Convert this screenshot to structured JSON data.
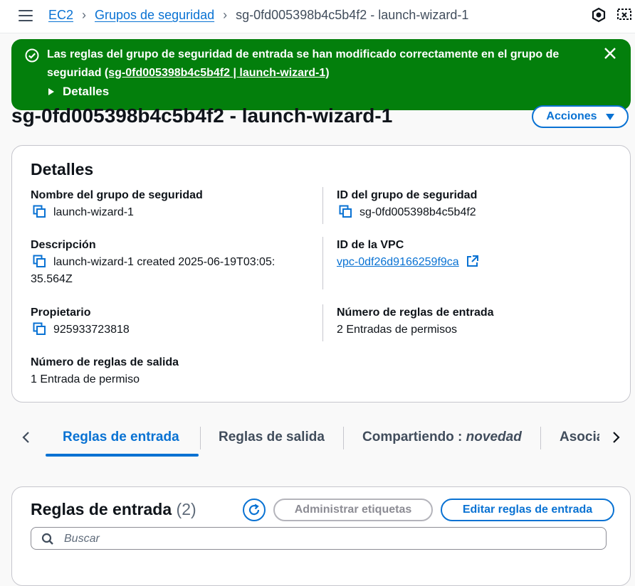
{
  "breadcrumb": {
    "items": [
      "EC2",
      "Grupos de seguridad"
    ],
    "current": "sg-0fd005398b4c5b4f2 - launch-wizard-1"
  },
  "flash": {
    "message": "Las reglas del grupo de seguridad de entrada se han modificado correctamente en el grupo de seguridad",
    "link": "(sg-0fd005398b4c5b4f2 | launch-wizard-1)",
    "details_label": "Detalles",
    "color": "#037f0c"
  },
  "page": {
    "title": "sg-0fd005398b4c5b4f2 - launch-wizard-1",
    "actions_label": "Acciones"
  },
  "details": {
    "heading": "Detalles",
    "group_name_label": "Nombre del grupo de seguridad",
    "group_name": "launch-wizard-1",
    "group_id_label": "ID del grupo de seguridad",
    "group_id": "sg-0fd005398b4c5b4f2",
    "description_label": "Descripción",
    "description_line1": "launch-wizard-1 created 2025-06-19T03:05:",
    "description_line2": "35.564Z",
    "vpc_label": "ID de la VPC",
    "vpc_id": "vpc-0df26d9166259f9ca",
    "owner_label": "Propietario",
    "owner": "925933723818",
    "inbound_count_label": "Número de reglas de entrada",
    "inbound_count": "2 Entradas de permisos",
    "outbound_count_label": "Número de reglas de salida",
    "outbound_count": "1 Entrada de permiso"
  },
  "tabs": {
    "items": [
      "Reglas de entrada",
      "Reglas de salida",
      "Compartiendo : ",
      "Asocia"
    ],
    "new_tag": "novedad",
    "active": "Reglas de entrada"
  },
  "rules": {
    "title": "Reglas de entrada",
    "count": "(2)",
    "manage_tags_label": "Administrar etiquetas",
    "edit_rules_label": "Editar reglas de entrada",
    "search_placeholder": "Buscar"
  },
  "colors": {
    "accent": "#0972d3",
    "success": "#037f0c",
    "text": "#0f141a"
  }
}
